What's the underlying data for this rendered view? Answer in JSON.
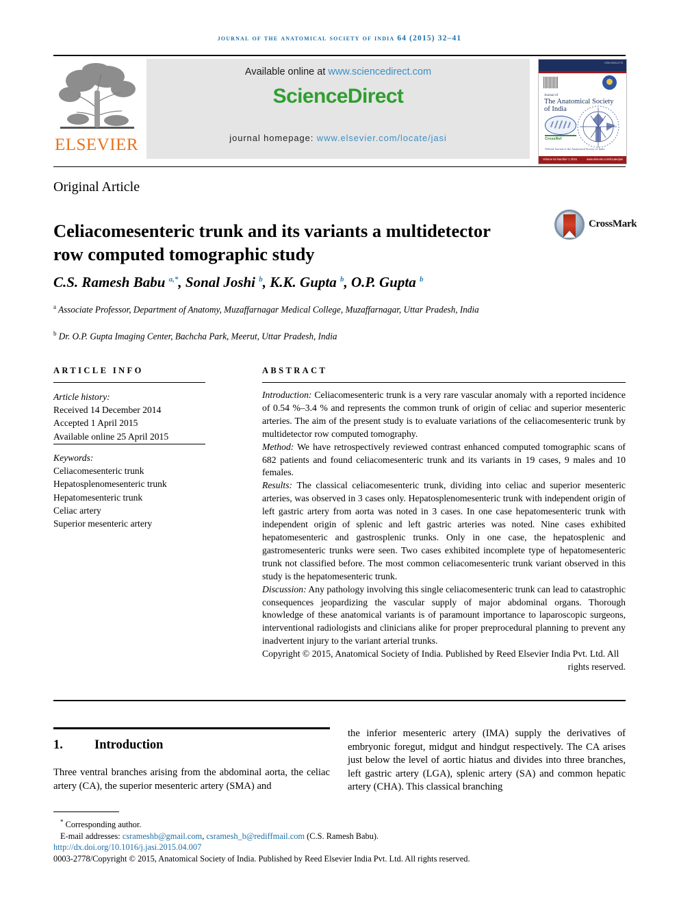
{
  "running_head": "Journal of the Anatomical Society of India 64 (2015) 32–41",
  "masthead": {
    "elsevier_wordmark": "ELSEVIER",
    "available_prefix": "Available online at ",
    "available_url": "www.sciencedirect.com",
    "sciencedirect_logo_a": "Science",
    "sciencedirect_logo_b": "Direct",
    "homepage_prefix": "journal homepage: ",
    "homepage_url": "www.elsevier.com/locate/jasi",
    "cover": {
      "issn_small": "ISSN 0003-2778",
      "journal_of": "Journal of",
      "title": "The Anatomical Society of India",
      "indexed_note": "Indexed in",
      "green_label": "CrossRef",
      "small_note": "Official Journal of\nthe Anatomical Society of India",
      "bottom_left": "Volume 64  Number 1  2015",
      "bottom_right": "www.elsevier.com/locate/jasi"
    }
  },
  "article": {
    "type": "Original Article",
    "title": "Celiacomesenteric trunk and its variants a multidetector row computed tomographic study",
    "crossmark_label": "CrossMark",
    "authors_html": "C.S. Ramesh Babu <sup>a,*</sup>, Sonal Joshi <sup>b</sup>, K.K. Gupta <sup>b</sup>, O.P. Gupta <sup>b</sup>",
    "affiliation_a_marker": "a",
    "affiliation_a": "Associate Professor, Department of Anatomy, Muzaffarnagar Medical College, Muzaffarnagar, Uttar Pradesh, India",
    "affiliation_b_marker": "b",
    "affiliation_b": "Dr. O.P. Gupta Imaging Center, Bachcha Park, Meerut, Uttar Pradesh, India"
  },
  "info": {
    "heading": "ARTICLE INFO",
    "history_label": "Article history:",
    "history": [
      "Received 14 December 2014",
      "Accepted 1 April 2015",
      "Available online 25 April 2015"
    ],
    "keywords_label": "Keywords:",
    "keywords": [
      "Celiacomesenteric trunk",
      "Hepatosplenomesenteric trunk",
      "Hepatomesenteric trunk",
      "Celiac artery",
      "Superior mesenteric artery"
    ]
  },
  "abstract": {
    "heading": "ABSTRACT",
    "introduction_label": "Introduction:",
    "introduction_text": " Celiacomesenteric trunk is a very rare vascular anomaly with a reported incidence of 0.54 %–3.4 % and represents the common trunk of origin of celiac and superior mesenteric arteries. The aim of the present study is to evaluate variations of the celiacomesenteric trunk by multidetector row computed tomography.",
    "method_label": "Method:",
    "method_text": " We have retrospectively reviewed contrast enhanced computed tomographic scans of 682 patients and found celiacomesenteric trunk and its variants in 19 cases, 9 males and 10 females.",
    "results_label": "Results:",
    "results_text": " The classical celiacomesenteric trunk, dividing into celiac and superior mesenteric arteries, was observed in 3 cases only. Hepatosplenomesenteric trunk with independent origin of left gastric artery from aorta was noted in 3 cases. In one case hepatomesenteric trunk with independent origin of splenic and left gastric arteries was noted. Nine cases exhibited hepatomesenteric and gastrosplenic trunks. Only in one case, the hepatosplenic and gastromesenteric trunks were seen. Two cases exhibited incomplete type of hepatomesenteric trunk not classified before. The most common celiacomesenteric trunk variant observed in this study is the hepatomesenteric trunk.",
    "discussion_label": "Discussion:",
    "discussion_text": " Any pathology involving this single celiacomesenteric trunk can lead to catastrophic consequences jeopardizing the vascular supply of major abdominal organs. Thorough knowledge of these anatomical variants is of paramount importance to laparoscopic surgeons, interventional radiologists and clinicians alike for proper preprocedural planning to prevent any inadvertent injury to the variant arterial trunks.",
    "copyright": "Copyright © 2015, Anatomical Society of India. Published by Reed Elsevier India Pvt. Ltd. All",
    "copyright_last": "rights reserved."
  },
  "body": {
    "section_number": "1.",
    "section_title": "Introduction",
    "left_paragraph": "Three ventral branches arising from the abdominal aorta, the celiac artery (CA), the superior mesenteric artery (SMA) and",
    "right_paragraph": "the inferior mesenteric artery (IMA) supply the derivatives of embryonic foregut, midgut and hindgut respectively. The CA arises just below the level of aortic hiatus and divides into three branches, left gastric artery (LGA), splenic artery (SA) and common hepatic artery (CHA). This classical branching"
  },
  "footer": {
    "corresponding_marker": "*",
    "corresponding_author": " Corresponding author.",
    "email_label": "E-mail addresses: ",
    "email_1": "csrameshb@gmail.com",
    "email_sep": ", ",
    "email_2": "csramesh_b@rediffmail.com",
    "email_attrib": " (C.S. Ramesh Babu).",
    "doi": "http://dx.doi.org/10.1016/j.jasi.2015.04.007",
    "issn_line": "0003-2778/Copyright © 2015, Anatomical Society of India. Published by Reed Elsevier India Pvt. Ltd. All rights reserved."
  },
  "colors": {
    "link_blue": "#1a6fa8",
    "sciencedirect_green": "#2f9e2f",
    "elsevier_orange": "#E8711A",
    "banner_gray": "#e5e5e5",
    "superscript_blue": "#2a7fb5"
  }
}
